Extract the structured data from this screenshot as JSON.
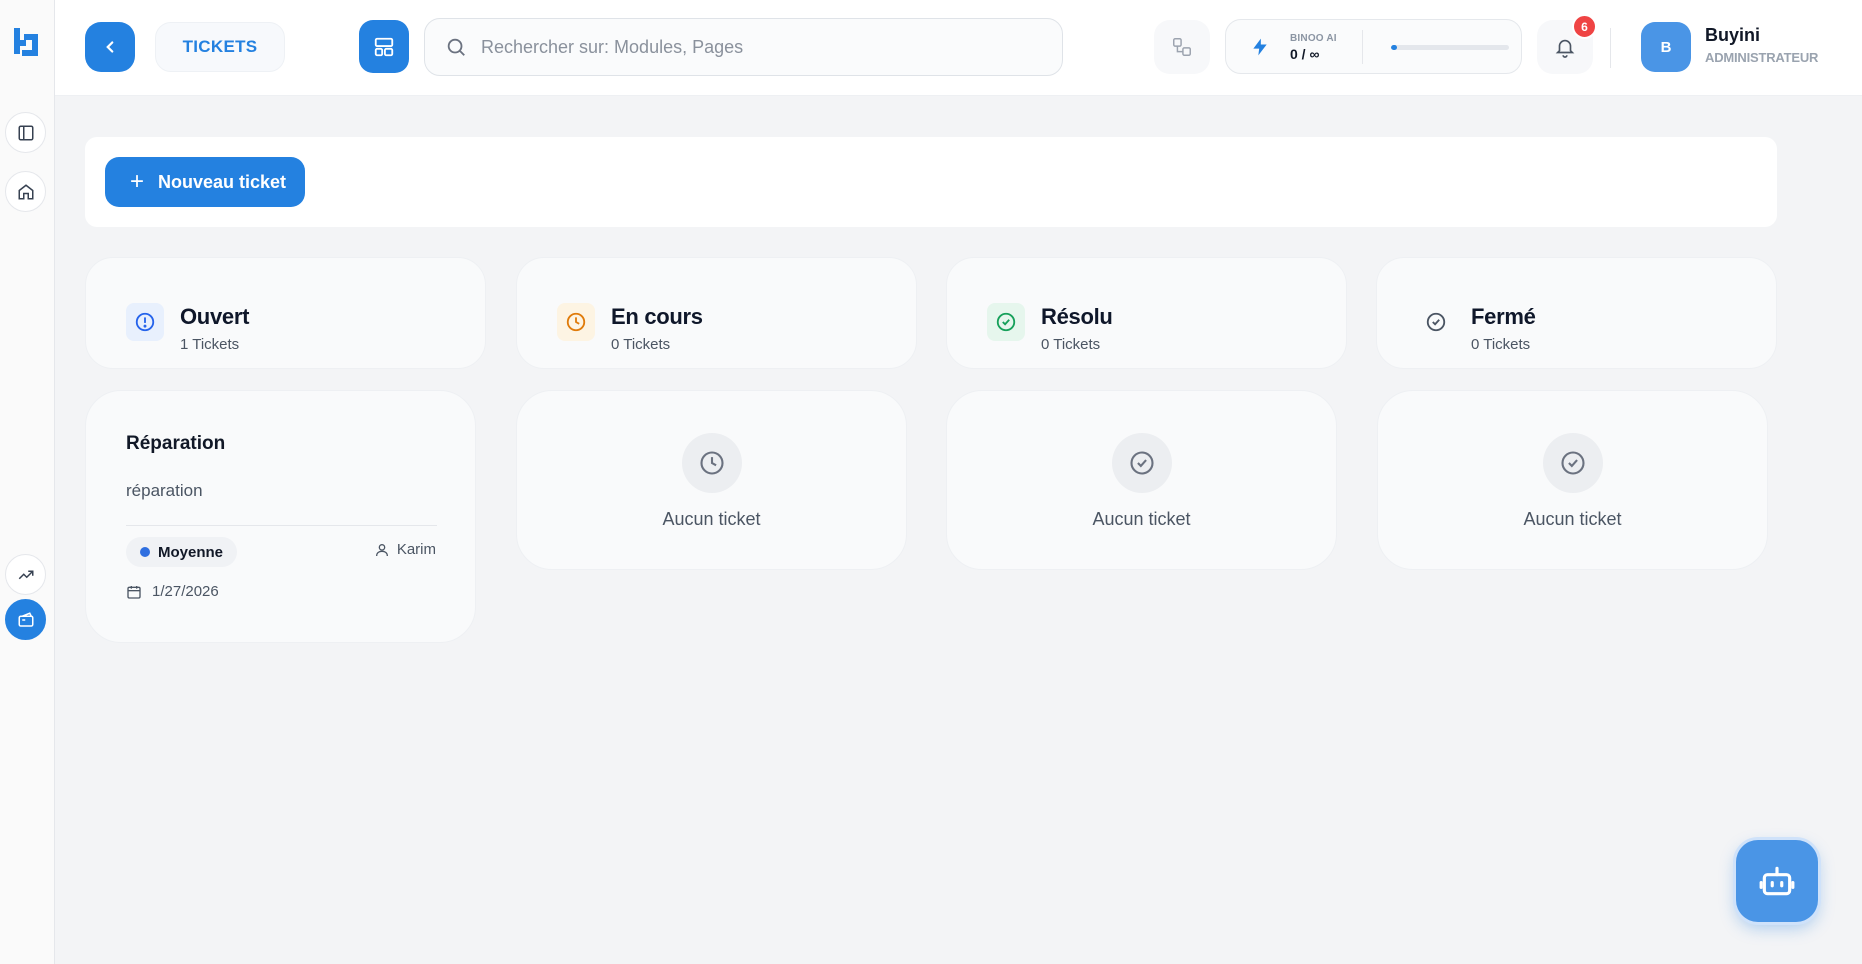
{
  "app": {
    "logo_icon": "brand-logo-icon"
  },
  "sidebar": {
    "items": [
      {
        "name": "toggle-sidebar",
        "icon": "panel-left-icon",
        "active": false
      },
      {
        "name": "home",
        "icon": "home-icon",
        "active": false
      },
      {
        "name": "analytics",
        "icon": "trending-up-icon",
        "active": false
      },
      {
        "name": "tickets",
        "icon": "ticket-icon",
        "active": true
      }
    ]
  },
  "header": {
    "page_title": "TICKETS",
    "search_placeholder": "Rechercher sur: Modules, Pages",
    "ai": {
      "label": "BINOO AI",
      "count": "0 / ∞",
      "usage_fraction": 0.05
    },
    "notifications": {
      "count": "6"
    },
    "user": {
      "initial": "B",
      "name": "Buyini",
      "role": "ADMINISTRATEUR"
    }
  },
  "toolbar": {
    "new_ticket_label": "Nouveau ticket",
    "plus": "+"
  },
  "columns": [
    {
      "key": "open",
      "title": "Ouvert",
      "count": "1 Tickets",
      "icon": "alert-circle-icon",
      "color": "#2563eb",
      "bg": "#e8f0fd"
    },
    {
      "key": "in_progress",
      "title": "En cours",
      "count": "0 Tickets",
      "icon": "clock-icon",
      "color": "#e07b0a",
      "bg": "#fdf4e3"
    },
    {
      "key": "resolved",
      "title": "Résolu",
      "count": "0 Tickets",
      "icon": "check-circle-icon",
      "color": "#16a05a",
      "bg": "#e6f6ed"
    },
    {
      "key": "closed",
      "title": "Fermé",
      "count": "0 Tickets",
      "icon": "check-circle-icon",
      "color": "#4b5563",
      "bg": "#f9fafb"
    }
  ],
  "tickets": [
    {
      "title": "Réparation",
      "description": "réparation",
      "priority": "Moyenne",
      "priority_color": "#2f6fe0",
      "assignee": "Karim",
      "date": "1/27/2026"
    }
  ],
  "empty": {
    "text": "Aucun ticket"
  },
  "colors": {
    "primary": "#2481e0",
    "badge": "#ef4444"
  }
}
